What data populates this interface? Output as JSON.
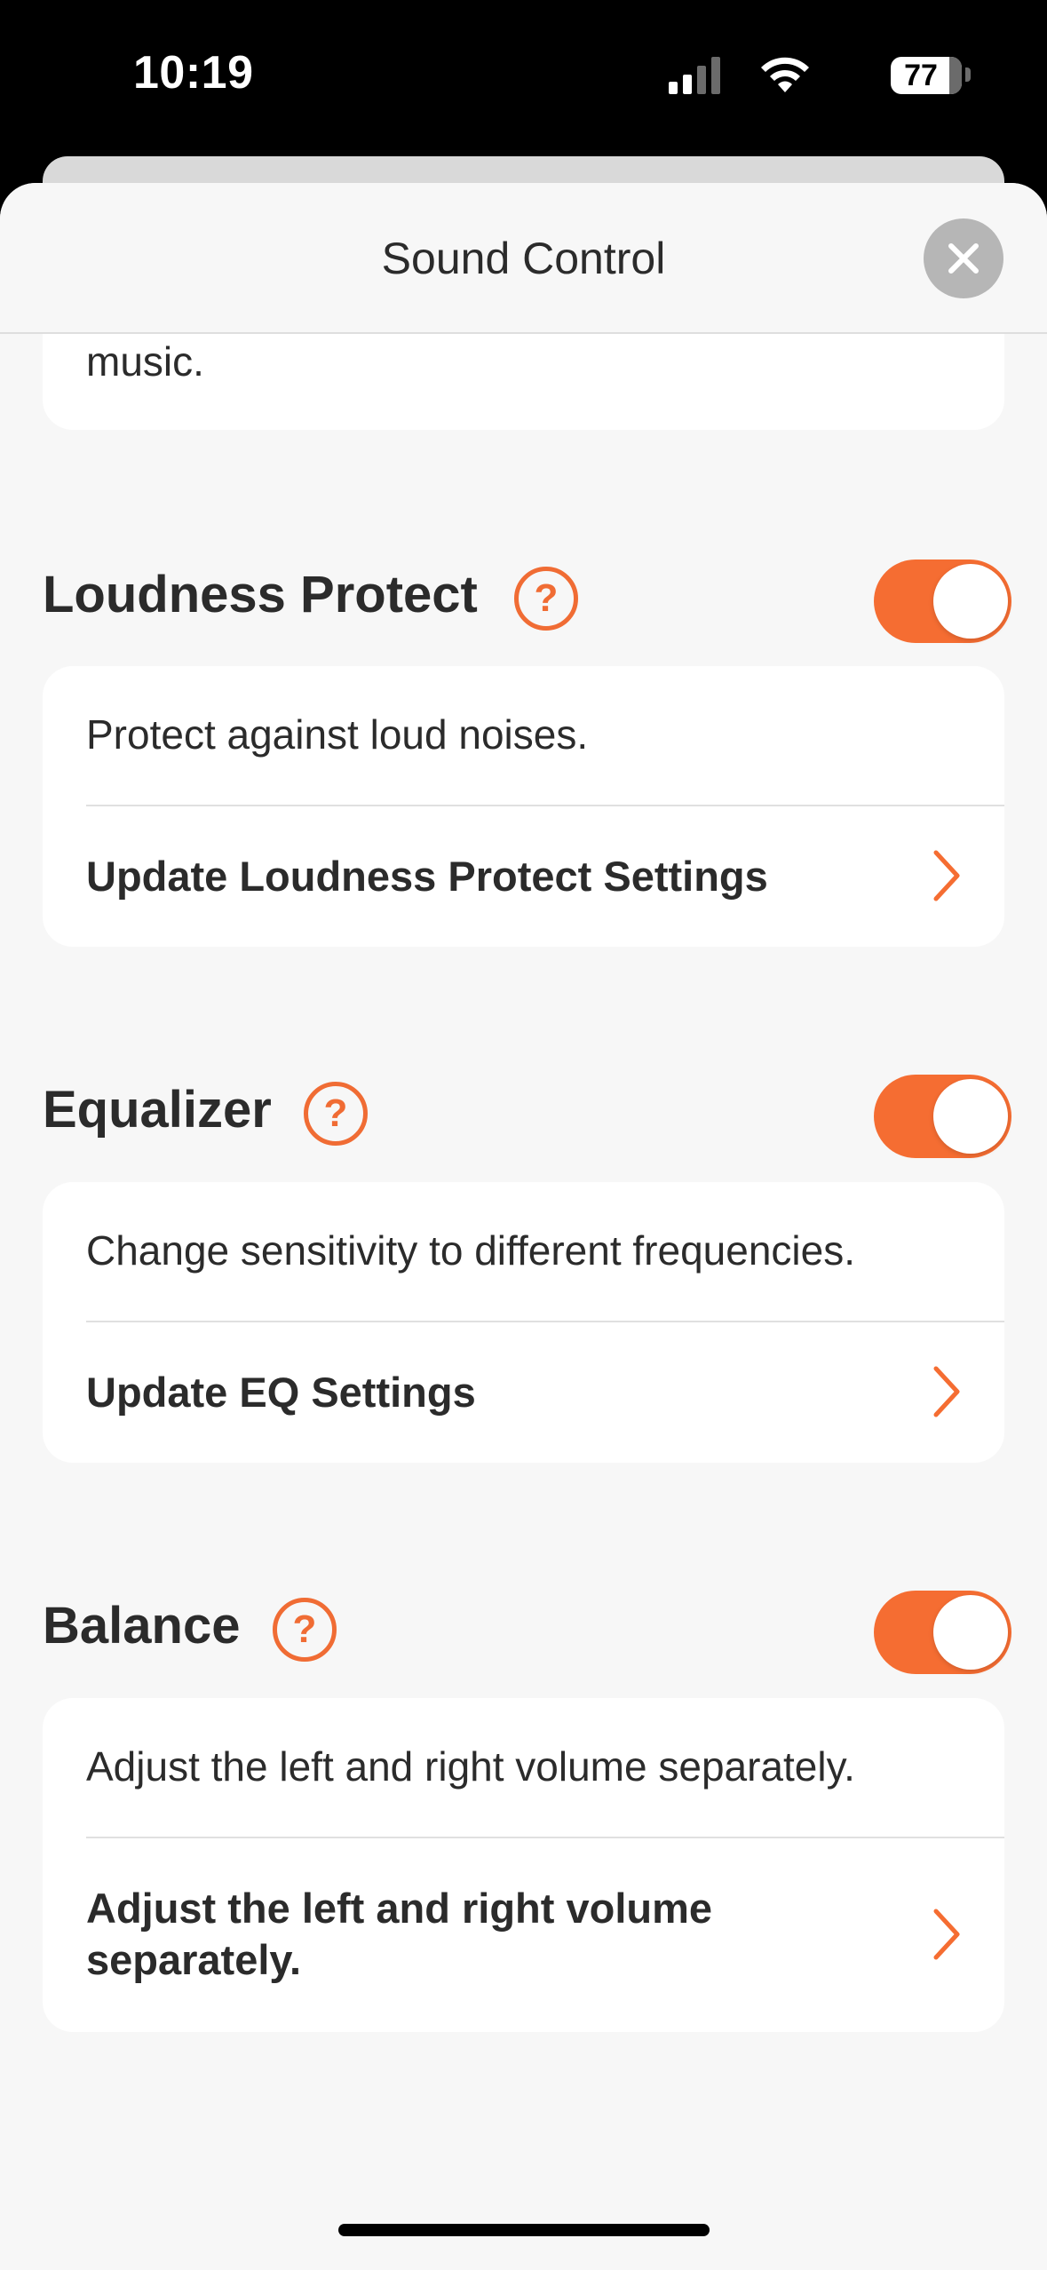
{
  "status_bar": {
    "time": "10:19",
    "battery": "77"
  },
  "header": {
    "title": "Sound Control"
  },
  "top_card": {
    "text": "music."
  },
  "sections": [
    {
      "title": "Loudness Protect",
      "enabled": true,
      "description": "Protect against loud noises.",
      "link_label": "Update Loudness Protect Settings"
    },
    {
      "title": "Equalizer",
      "enabled": true,
      "description": "Change sensitivity to different frequencies.",
      "link_label": "Update EQ Settings"
    },
    {
      "title": "Balance",
      "enabled": true,
      "description": "Adjust the left and right volume separately.",
      "link_label": "Adjust the left and right volume separately."
    }
  ],
  "help_icon_glyph": "?",
  "colors": {
    "accent": "#F56D32",
    "background": "#F7F7F7",
    "card": "#FFFFFF",
    "text": "#2B2B2B"
  }
}
